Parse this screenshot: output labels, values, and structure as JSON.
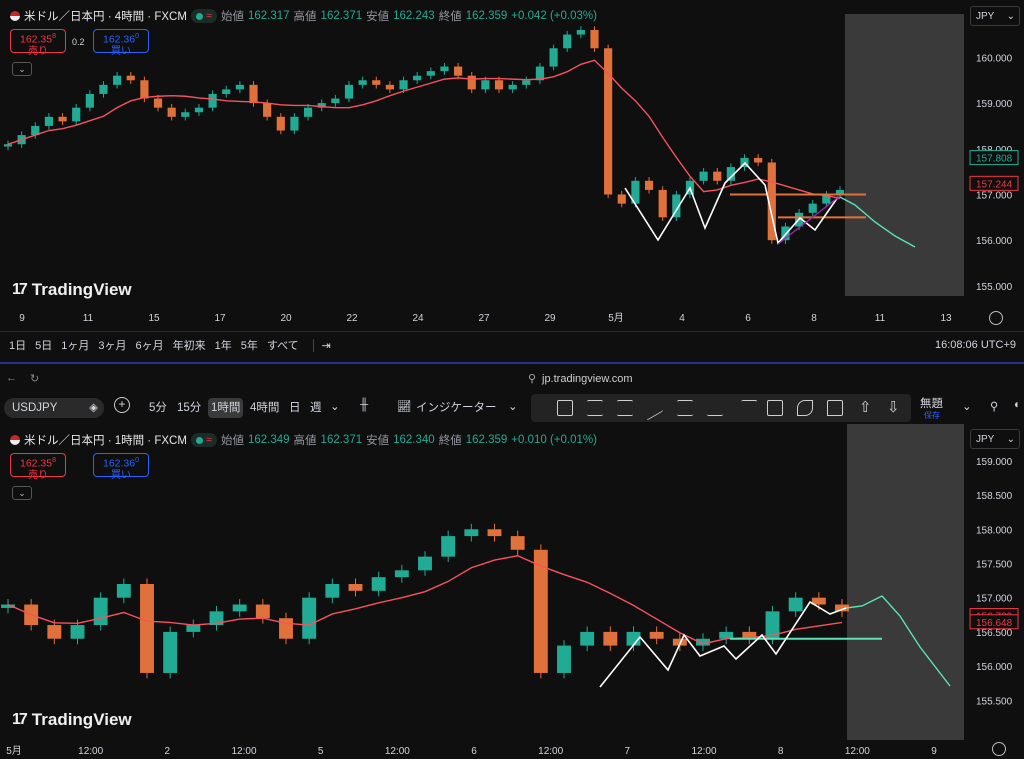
{
  "top": {
    "symbol_title": "米ドル／日本円 · 4時間 · FXCM",
    "ohlc": {
      "open_label": "始値",
      "open": "162.317",
      "high_label": "高値",
      "high": "162.371",
      "low_label": "安値",
      "low": "162.243",
      "close_label": "終値",
      "close": "162.359",
      "change": "+0.042 (+0.03%)"
    },
    "sell": {
      "price": "162.35",
      "sup": "8",
      "label": "売り"
    },
    "spread": "0.2",
    "buy": {
      "price": "162.36",
      "sup": "0",
      "label": "買い"
    },
    "currency": "JPY",
    "price_ticks": [
      "160.000",
      "159.000",
      "158.000",
      "157.000",
      "156.000",
      "155.000"
    ],
    "price_tags": [
      {
        "value": "157.808",
        "color": "#22ab94"
      },
      {
        "value": "157.244",
        "color": "#f23645"
      }
    ],
    "time_ticks": [
      "9",
      "11",
      "15",
      "17",
      "20",
      "22",
      "24",
      "27",
      "29",
      "5月",
      "4",
      "6",
      "8",
      "11",
      "13"
    ],
    "ranges": [
      "1日",
      "5日",
      "1ヶ月",
      "3ヶ月",
      "6ヶ月",
      "年初来",
      "1年",
      "5年",
      "すべて"
    ],
    "clock": "16:08:06 UTC+9",
    "logo": "TradingView"
  },
  "browser": {
    "url": "jp.tradingview.com"
  },
  "toolbar": {
    "symbol": "USDJPY",
    "intervals": [
      "5分",
      "15分",
      "1時間",
      "4時間",
      "日",
      "週"
    ],
    "indicators_label": "インジケーター",
    "layout_name": "無題",
    "layout_sub": "保存"
  },
  "bottom": {
    "symbol_title": "米ドル／日本円 · 1時間 · FXCM",
    "ohlc": {
      "open_label": "始値",
      "open": "162.349",
      "high_label": "高値",
      "high": "162.371",
      "low_label": "安値",
      "low": "162.340",
      "close_label": "終値",
      "close": "162.359",
      "change": "+0.010 (+0.01%)"
    },
    "sell": {
      "price": "162.35",
      "sup": "8",
      "label": "売り"
    },
    "spread": "",
    "buy": {
      "price": "162.36",
      "sup": "0",
      "label": "買い"
    },
    "currency": "JPY",
    "price_ticks": [
      "159.000",
      "158.500",
      "158.000",
      "157.500",
      "157.000",
      "156.500",
      "156.000",
      "155.500"
    ],
    "price_tags": [
      {
        "value": "156.739",
        "color": "#f23645"
      },
      {
        "value": "156.648",
        "color": "#f23645"
      }
    ],
    "time_ticks": [
      "5月",
      "12:00",
      "2",
      "12:00",
      "5",
      "12:00",
      "6",
      "12:00",
      "7",
      "12:00",
      "8",
      "12:00",
      "9"
    ],
    "logo": "TradingView"
  },
  "chart_data": [
    {
      "type": "candlestick",
      "title": "米ドル／日本円 · 4時間 · FXCM",
      "ylim": [
        154.8,
        160.6
      ],
      "x_labels": [
        "9",
        "11",
        "15",
        "17",
        "20",
        "22",
        "24",
        "27",
        "29",
        "5月",
        "4",
        "6",
        "8",
        "11",
        "13"
      ],
      "series": [
        {
          "values": [
            158.1,
            158.3,
            158.5,
            158.7,
            158.6,
            158.9,
            159.2,
            159.4,
            159.6,
            159.5,
            159.1,
            158.9,
            158.7,
            158.8,
            158.9,
            159.2,
            159.3,
            159.4,
            159.0,
            158.7,
            158.4,
            158.7,
            158.9,
            159.0,
            159.1,
            159.4,
            159.5,
            159.4,
            159.3,
            159.5,
            159.6,
            159.7,
            159.8,
            159.6,
            159.3,
            159.5,
            159.3,
            159.4,
            159.5,
            159.8,
            160.2,
            160.5,
            160.6,
            160.2,
            157.0,
            156.8,
            157.3,
            157.1,
            156.5,
            157.0,
            157.3,
            157.5,
            157.3,
            157.6,
            157.8,
            157.7,
            156.0,
            156.3,
            156.6,
            156.8,
            157.0,
            157.1
          ]
        }
      ],
      "moving_average": {
        "color": "#f7525f"
      },
      "drawings": {
        "horizontal_levels": [
          157.0,
          156.5
        ],
        "channel_color": "#9c27b0"
      }
    },
    {
      "type": "candlestick",
      "title": "米ドル／日本円 · 1時間 · FXCM",
      "ylim": [
        155.3,
        159.1
      ],
      "x_labels": [
        "5月",
        "12:00",
        "2",
        "12:00",
        "5",
        "12:00",
        "6",
        "12:00",
        "7",
        "12:00",
        "8",
        "12:00",
        "9"
      ],
      "series": [
        {
          "values": [
            156.9,
            156.6,
            156.4,
            156.6,
            157.0,
            157.2,
            155.9,
            156.5,
            156.6,
            156.8,
            156.9,
            156.7,
            156.4,
            157.0,
            157.2,
            157.1,
            157.3,
            157.4,
            157.6,
            157.9,
            158.0,
            157.9,
            157.7,
            155.9,
            156.3,
            156.5,
            156.3,
            156.5,
            156.4,
            156.3,
            156.4,
            156.5,
            156.4,
            156.8,
            157.0,
            156.9,
            156.8
          ]
        }
      ],
      "moving_average": {
        "color": "#f7525f"
      },
      "drawings": {
        "horizontal_levels": [
          156.4
        ],
        "projection_color": "#5be3b6"
      }
    }
  ]
}
